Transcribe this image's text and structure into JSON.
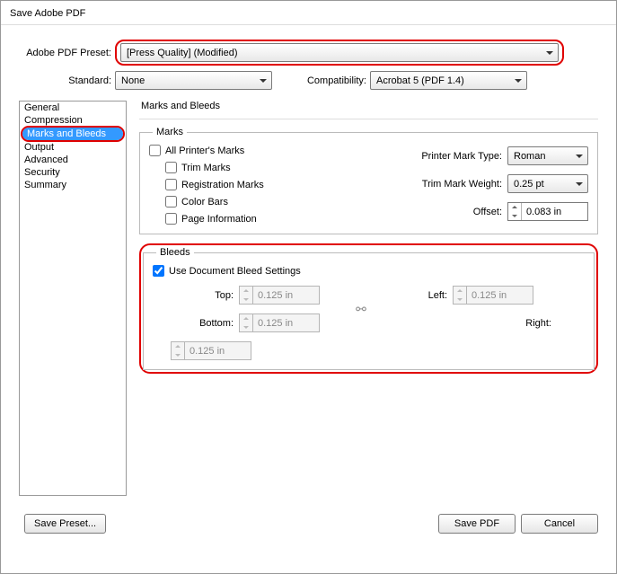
{
  "window": {
    "title": "Save Adobe PDF"
  },
  "preset": {
    "label": "Adobe PDF Preset:",
    "value": "[Press Quality] (Modified)"
  },
  "standard": {
    "label": "Standard:",
    "value": "None"
  },
  "compatibility": {
    "label": "Compatibility:",
    "value": "Acrobat 5 (PDF 1.4)"
  },
  "sidebar": {
    "items": [
      {
        "label": "General"
      },
      {
        "label": "Compression"
      },
      {
        "label": "Marks and Bleeds"
      },
      {
        "label": "Output"
      },
      {
        "label": "Advanced"
      },
      {
        "label": "Security"
      },
      {
        "label": "Summary"
      }
    ],
    "selectedIndex": 2
  },
  "panel": {
    "title": "Marks and Bleeds"
  },
  "marks": {
    "legend": "Marks",
    "allPrinters": "All Printer's Marks",
    "trimMarks": "Trim Marks",
    "registrationMarks": "Registration Marks",
    "colorBars": "Color Bars",
    "pageInformation": "Page Information",
    "printerMarkTypeLabel": "Printer Mark Type:",
    "printerMarkTypeValue": "Roman",
    "trimMarkWeightLabel": "Trim Mark Weight:",
    "trimMarkWeightValue": "0.25 pt",
    "offsetLabel": "Offset:",
    "offsetValue": "0.083 in"
  },
  "bleeds": {
    "legend": "Bleeds",
    "useDocument": "Use Document Bleed Settings",
    "topLabel": "Top:",
    "bottomLabel": "Bottom:",
    "leftLabel": "Left:",
    "rightLabel": "Right:",
    "value": "0.125 in"
  },
  "footer": {
    "savePreset": "Save Preset...",
    "savePDF": "Save PDF",
    "cancel": "Cancel"
  }
}
